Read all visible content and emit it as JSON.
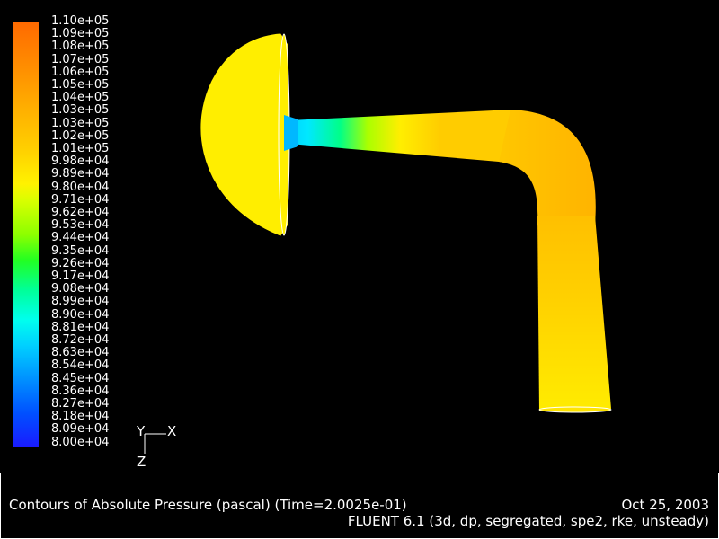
{
  "colorbar": {
    "labels": [
      "1.10e+05",
      "1.09e+05",
      "1.08e+05",
      "1.07e+05",
      "1.06e+05",
      "1.05e+05",
      "1.04e+05",
      "1.03e+05",
      "1.03e+05",
      "1.02e+05",
      "1.01e+05",
      "9.98e+04",
      "9.89e+04",
      "9.80e+04",
      "9.71e+04",
      "9.62e+04",
      "9.53e+04",
      "9.44e+04",
      "9.35e+04",
      "9.26e+04",
      "9.17e+04",
      "9.08e+04",
      "8.99e+04",
      "8.90e+04",
      "8.81e+04",
      "8.72e+04",
      "8.63e+04",
      "8.54e+04",
      "8.45e+04",
      "8.36e+04",
      "8.27e+04",
      "8.18e+04",
      "8.09e+04",
      "8.00e+04"
    ]
  },
  "axes": {
    "y": "Y",
    "x": "X",
    "z": "Z"
  },
  "info": {
    "caption": "Contours of Absolute Pressure (pascal)  (Time=2.0025e-01)",
    "date": "Oct 25, 2003",
    "solver": "FLUENT 6.1 (3d, dp, segregated, spe2, rke, unsteady)"
  },
  "colors": {
    "background": "#000000",
    "text": "#ffffff",
    "dome": "#ffee00",
    "pipe_outlet": "#ffe400",
    "pipe_elbow": "#ffb800"
  }
}
